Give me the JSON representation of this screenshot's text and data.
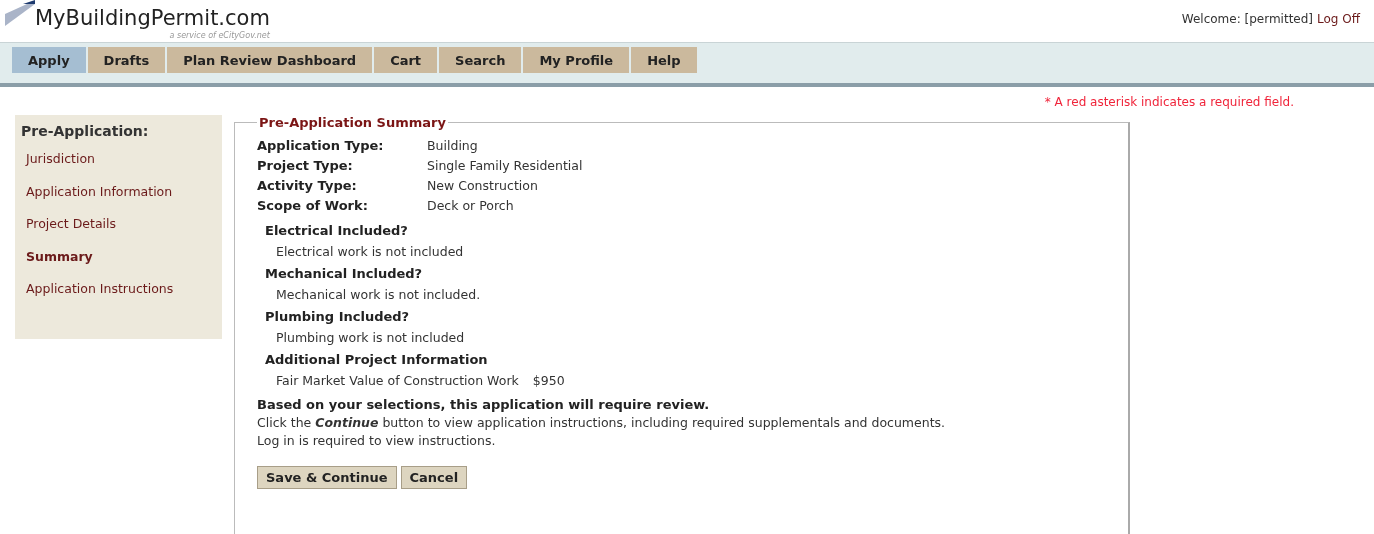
{
  "header": {
    "logo": "MyBuildingPermit.com",
    "tagline": "a service of eCityGov.net",
    "welcome": "Welcome: [permitted]",
    "logoff": "Log Off"
  },
  "tabs": [
    {
      "label": "Apply",
      "selected": true
    },
    {
      "label": "Drafts",
      "selected": false
    },
    {
      "label": "Plan Review Dashboard",
      "selected": false
    },
    {
      "label": "Cart",
      "selected": false
    },
    {
      "label": "Search",
      "selected": false
    },
    {
      "label": "My Profile",
      "selected": false
    },
    {
      "label": "Help",
      "selected": false
    }
  ],
  "required_note": "* A red asterisk indicates a required field.",
  "sidebar": {
    "title": "Pre-Application:",
    "items": [
      {
        "label": "Jurisdiction",
        "selected": false
      },
      {
        "label": "Application Information",
        "selected": false
      },
      {
        "label": "Project Details",
        "selected": false
      },
      {
        "label": "Summary",
        "selected": true
      },
      {
        "label": "Application Instructions",
        "selected": false
      }
    ]
  },
  "summary": {
    "legend": "Pre-Application Summary",
    "fields": [
      {
        "label": "Application Type:",
        "value": "Building"
      },
      {
        "label": "Project Type:",
        "value": "Single Family Residential"
      },
      {
        "label": "Activity Type:",
        "value": "New Construction"
      },
      {
        "label": "Scope of Work:",
        "value": "Deck or Porch"
      }
    ],
    "sections": [
      {
        "heading": "Electrical Included?",
        "text": "Electrical work is not included"
      },
      {
        "heading": "Mechanical Included?",
        "text": "Mechanical work is not included."
      },
      {
        "heading": "Plumbing Included?",
        "text": "Plumbing work is not included"
      },
      {
        "heading": "Additional Project Information",
        "text": "Fair Market Value of Construction Work",
        "amount": "$950"
      }
    ],
    "review_note": "Based on your selections, this application will require review.",
    "instructions": [
      "Click the *Continue* button to view application instructions, including required supplementals and documents.",
      "Log in is required to view instructions."
    ],
    "buttons": [
      "Save & Continue",
      "Cancel"
    ]
  }
}
